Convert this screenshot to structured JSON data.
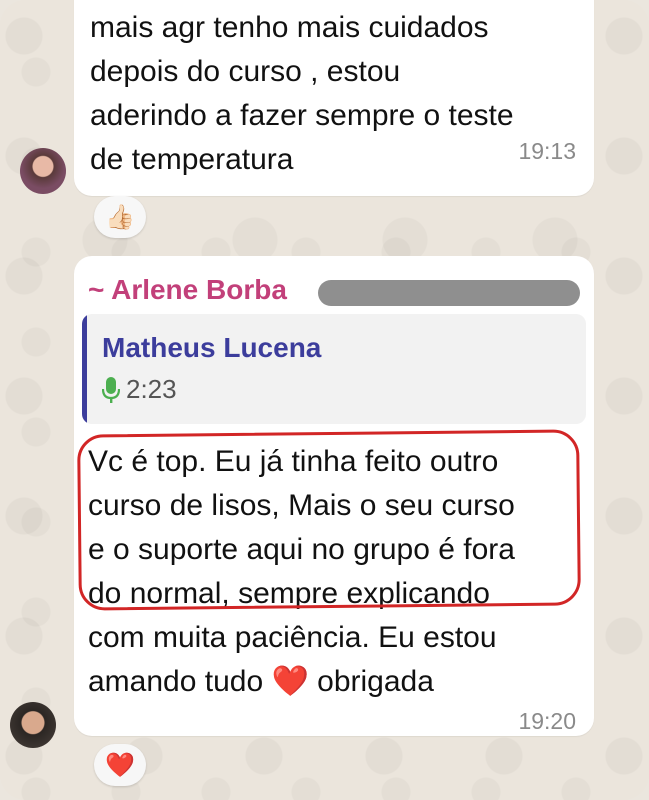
{
  "messages": [
    {
      "text": "mais agr tenho mais cuidados\ndepois do curso , estou\naderindo a fazer sempre o teste\nde temperatura",
      "time": "19:13",
      "reaction": "👍🏻"
    },
    {
      "sender": "~ Arlene Borba",
      "quote": {
        "name": "Matheus Lucena",
        "audio_duration": "2:23"
      },
      "text": "Vc é top. Eu já tinha feito outro\ncurso de lisos, Mais o seu curso\ne o suporte aqui no grupo é fora\ndo normal, sempre explicando\ncom muita paciência.  Eu estou\namando tudo ❤️ obrigada",
      "time": "19:20",
      "reaction": "❤️"
    }
  ],
  "colors": {
    "sender": "#c2407a",
    "quote_name": "#3c3d9c",
    "mic": "#4caf50",
    "highlight": "#d22626"
  }
}
